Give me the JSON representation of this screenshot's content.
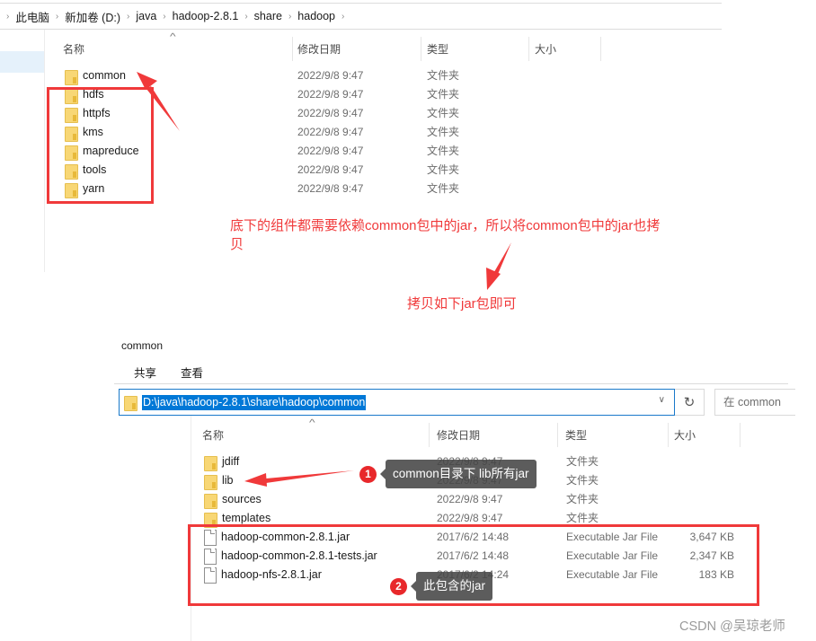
{
  "top_explorer": {
    "breadcrumb": [
      "此电脑",
      "新加卷 (D:)",
      "java",
      "hadoop-2.8.1",
      "share",
      "hadoop"
    ],
    "columns": {
      "name": "名称",
      "date": "修改日期",
      "type": "类型",
      "size": "大小"
    },
    "rows": [
      {
        "icon": "folder-icon",
        "name": "common",
        "date": "2022/9/8 9:47",
        "type": "文件夹",
        "size": ""
      },
      {
        "icon": "folder-icon",
        "name": "hdfs",
        "date": "2022/9/8 9:47",
        "type": "文件夹",
        "size": ""
      },
      {
        "icon": "folder-icon",
        "name": "httpfs",
        "date": "2022/9/8 9:47",
        "type": "文件夹",
        "size": ""
      },
      {
        "icon": "folder-icon",
        "name": "kms",
        "date": "2022/9/8 9:47",
        "type": "文件夹",
        "size": ""
      },
      {
        "icon": "folder-icon",
        "name": "mapreduce",
        "date": "2022/9/8 9:47",
        "type": "文件夹",
        "size": ""
      },
      {
        "icon": "folder-icon",
        "name": "tools",
        "date": "2022/9/8 9:47",
        "type": "文件夹",
        "size": ""
      },
      {
        "icon": "folder-icon",
        "name": "yarn",
        "date": "2022/9/8 9:47",
        "type": "文件夹",
        "size": ""
      }
    ]
  },
  "annotations": {
    "note1_line1": "底下的组件都需要依赖common包中的jar，所以将common包中的jar也拷",
    "note1_line2": "贝",
    "note2": "拷贝如下jar包即可"
  },
  "bottom_explorer": {
    "window_title": "common",
    "ribbon_tabs": [
      "共享",
      "查看"
    ],
    "address_path": "D:\\java\\hadoop-2.8.1\\share\\hadoop\\common",
    "search_placeholder": "在 common",
    "columns": {
      "name": "名称",
      "date": "修改日期",
      "type": "类型",
      "size": "大小"
    },
    "rows": [
      {
        "icon": "folder-icon",
        "name": "jdiff",
        "date": "2022/9/8 9:47",
        "type": "文件夹",
        "size": ""
      },
      {
        "icon": "folder-icon",
        "name": "lib",
        "date": "2022/9/8 9:47",
        "type": "文件夹",
        "size": ""
      },
      {
        "icon": "folder-icon",
        "name": "sources",
        "date": "2022/9/8 9:47",
        "type": "文件夹",
        "size": ""
      },
      {
        "icon": "folder-icon",
        "name": "templates",
        "date": "2022/9/8 9:47",
        "type": "文件夹",
        "size": ""
      },
      {
        "icon": "file-icon",
        "name": "hadoop-common-2.8.1.jar",
        "date": "2017/6/2 14:48",
        "type": "Executable Jar File",
        "size": "3,647 KB"
      },
      {
        "icon": "file-icon",
        "name": "hadoop-common-2.8.1-tests.jar",
        "date": "2017/6/2 14:48",
        "type": "Executable Jar File",
        "size": "2,347 KB"
      },
      {
        "icon": "file-icon",
        "name": "hadoop-nfs-2.8.1.jar",
        "date": "2017/6/2 14:24",
        "type": "Executable Jar File",
        "size": "183 KB"
      }
    ],
    "callouts": [
      {
        "number": "1",
        "text": "common目录下 lib所有jar"
      },
      {
        "number": "2",
        "text": "此包含的jar"
      }
    ]
  },
  "colors": {
    "annotation_red": "#f0393a",
    "selection_blue": "#0078d7",
    "callout_bg": "#464646"
  },
  "watermark": "CSDN @吴琼老师"
}
